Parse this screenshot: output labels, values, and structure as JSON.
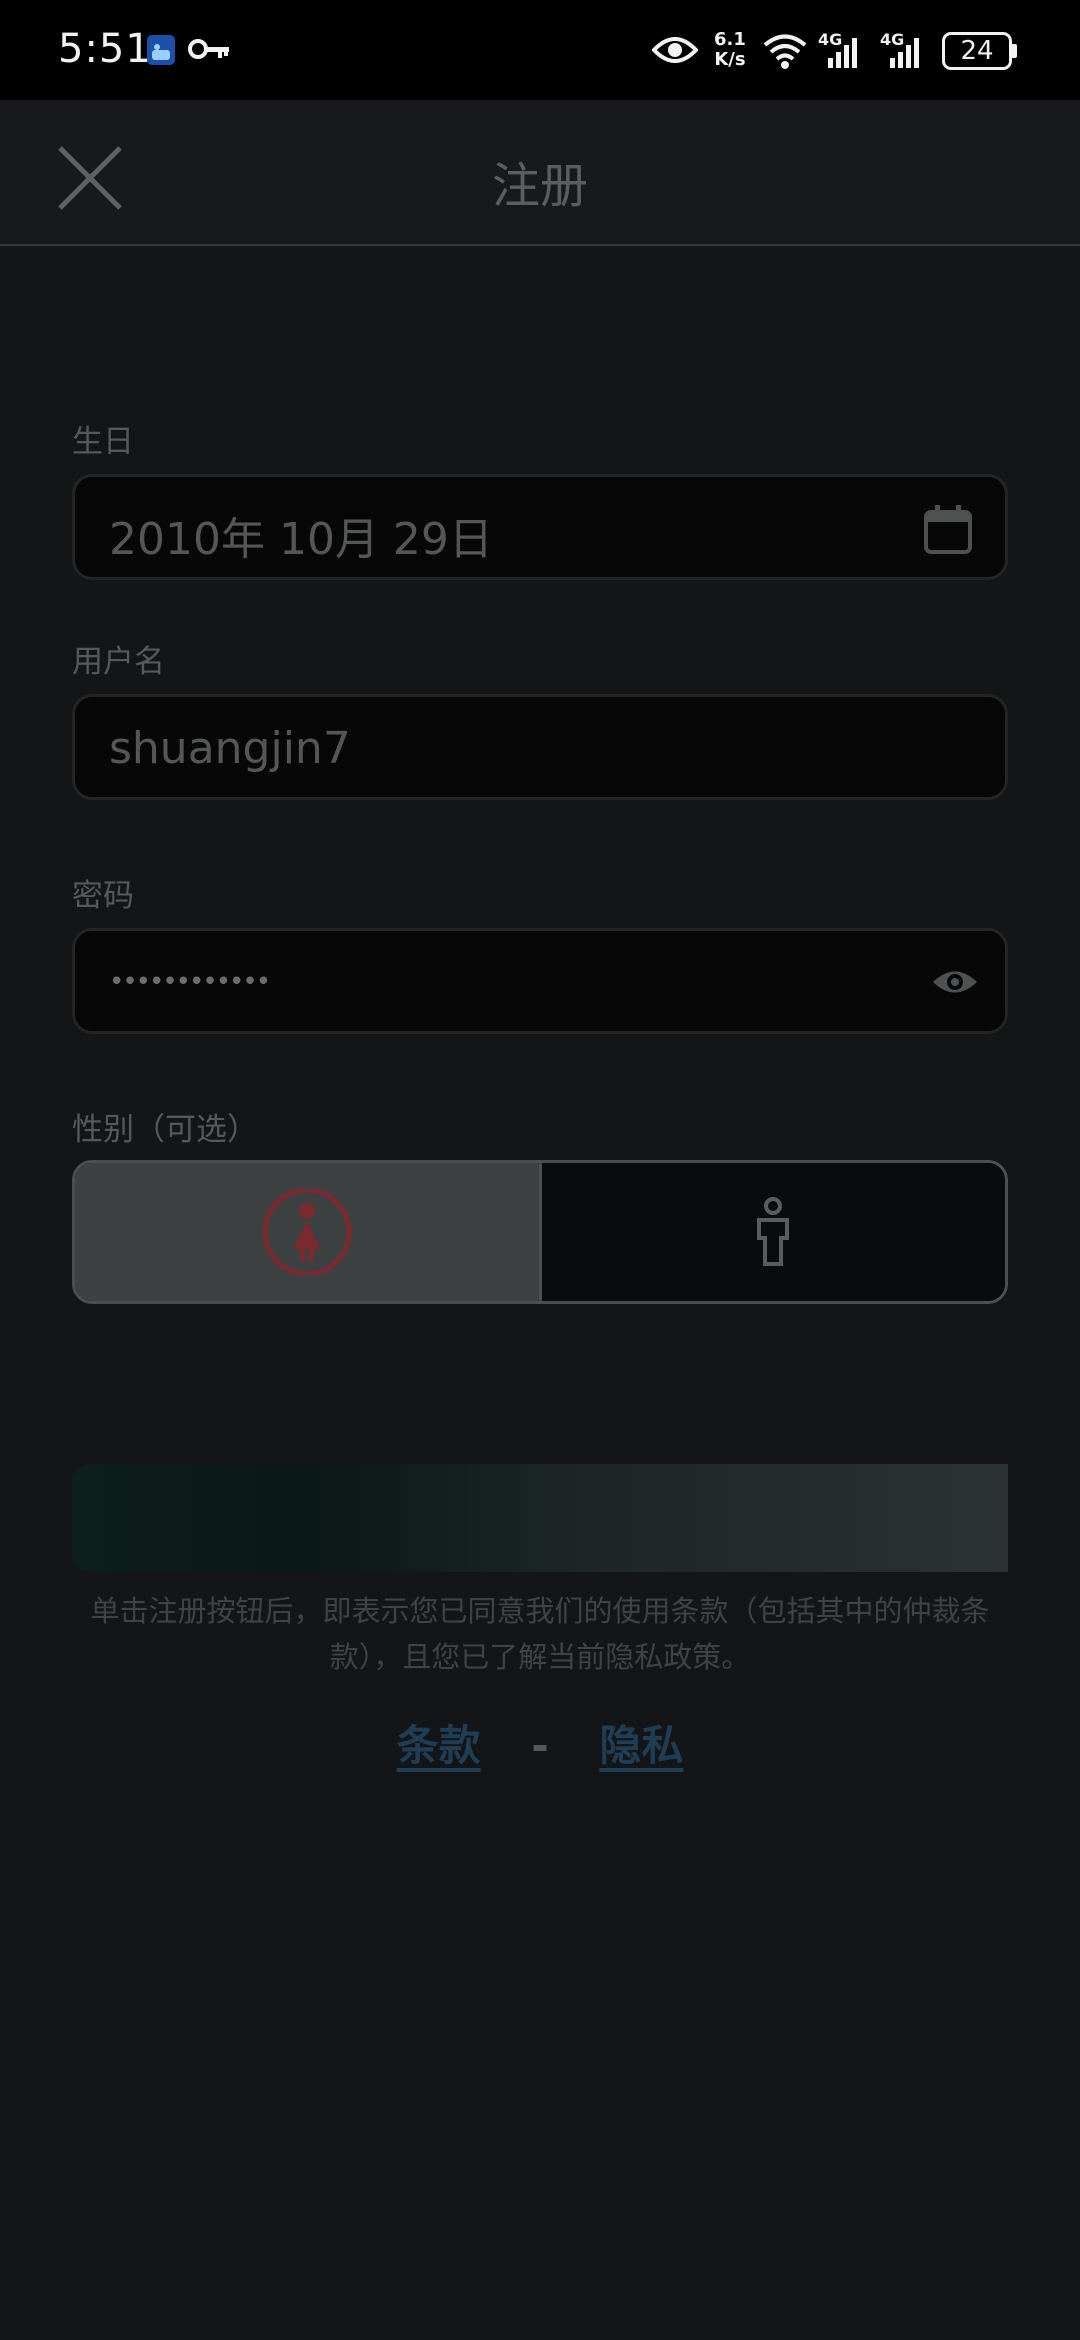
{
  "status_bar": {
    "time": "5:51",
    "net_speed_value": "6.1",
    "net_speed_unit": "K/s",
    "signal1": "4G",
    "signal2": "4G",
    "battery": "24",
    "icons": [
      "app-icon",
      "key-icon",
      "eye-icon",
      "wifi-icon",
      "signal-icon",
      "signal-icon",
      "battery-icon"
    ]
  },
  "header": {
    "title": "注册",
    "close_icon": "close-icon"
  },
  "form": {
    "birthday_label": "生日",
    "birthday_value": "2010年 10月 29日",
    "username_label": "用户名",
    "username_value": "shuangjin7",
    "password_label": "密码",
    "password_value": "••••••••••••",
    "gender_label": "性别（可选）",
    "gender_selected": "female"
  },
  "terms": {
    "text": "单击注册按钮后，即表示您已同意我们的使用条款（包括其中的仲裁条款），且您已了解当前隐私政策。",
    "terms_link": "条款",
    "separator": "-",
    "privacy_link": "隐私"
  },
  "colors": {
    "background": "#131516",
    "accent_link": "#1f3d55",
    "female_icon": "#7a2a2e"
  }
}
